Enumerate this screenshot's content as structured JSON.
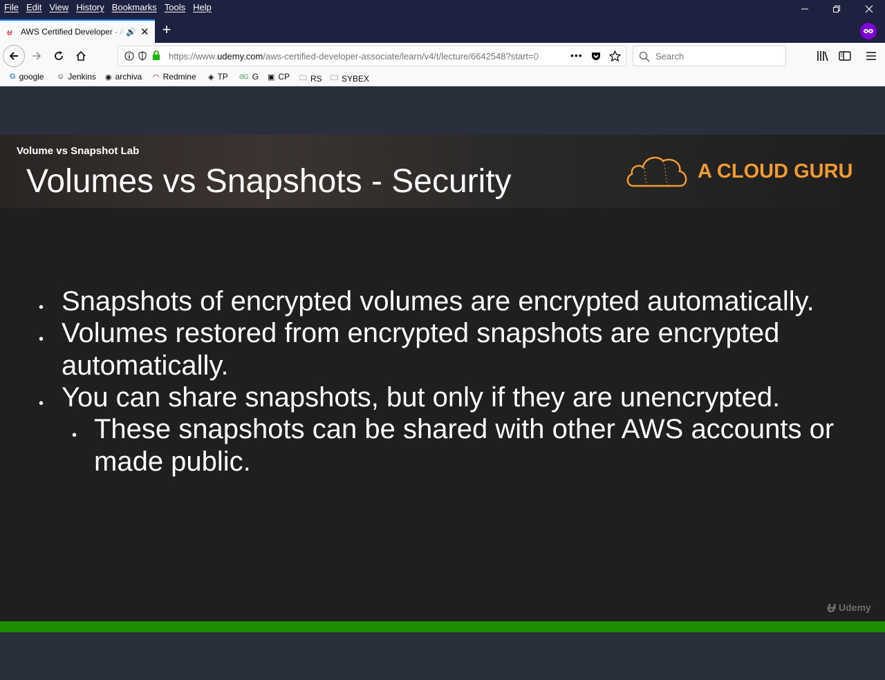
{
  "menu": [
    "File",
    "Edit",
    "View",
    "History",
    "Bookmarks",
    "Tools",
    "Help"
  ],
  "tab": {
    "title": "AWS Certified Developer - Associate",
    "new_tab": "+"
  },
  "url": {
    "prefix": "https://www.",
    "domain": "udemy.com",
    "path": "/aws-certified-developer-associate/learn/v4/t/lecture/6642548?start=0"
  },
  "search": {
    "placeholder": "Search"
  },
  "bookmarks": [
    "google",
    "Jenkins",
    "archiva",
    "Redmine",
    "TP",
    "G",
    "CP",
    "RS",
    "SYBEX"
  ],
  "slide": {
    "lab": "Volume vs Snapshot Lab",
    "title": "Volumes vs Snapshots - Security",
    "brand": "A CLOUD GURU",
    "bullets": [
      "Snapshots of encrypted volumes are encrypted automatically.",
      "Volumes restored from encrypted snapshots are encrypted automatically.",
      "You can share snapshots, but only if they are unencrypted."
    ],
    "sub_bullet": "These snapshots can be shared with other AWS accounts or made public."
  },
  "watermark": "Udemy",
  "progress_fraction": 1.0,
  "colors": {
    "accent": "#0a84ff",
    "brand": "#f29a32",
    "progress": "#1f8d04",
    "udemy": "#ec5252"
  }
}
